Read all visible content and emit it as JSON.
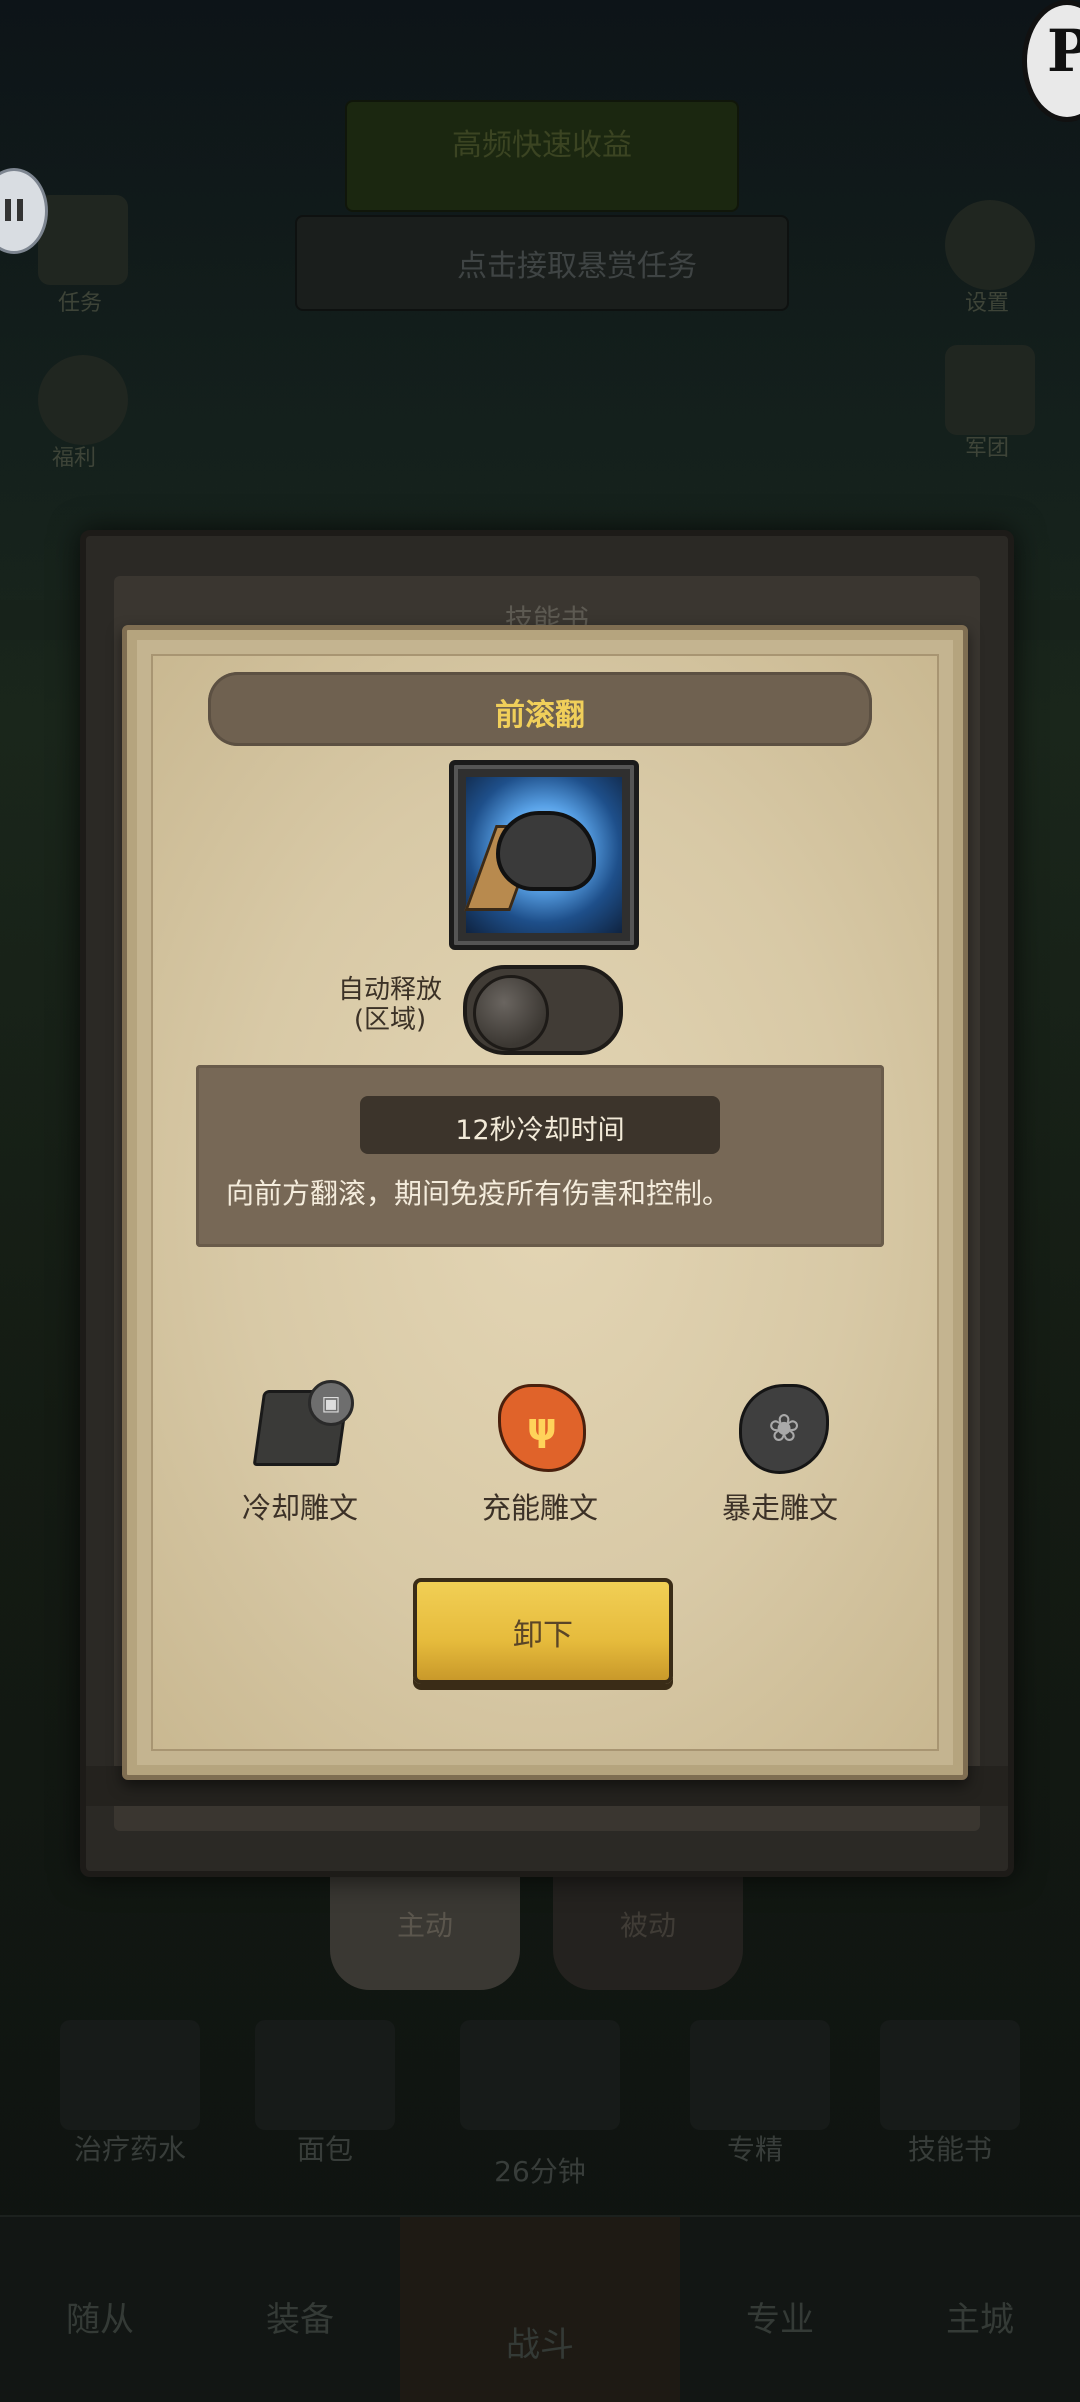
{
  "background": {
    "top_banner": "高频快速收益",
    "quest_button": "点击接取悬赏任务",
    "left_icons": [
      "任务",
      "福利"
    ],
    "right_icons": [
      "设置",
      "军团"
    ],
    "skill_book_title": "技能书",
    "tabs": [
      "主动",
      "被动"
    ],
    "items": [
      "治疗药水",
      "面包",
      "专精",
      "技能书"
    ],
    "timer": "26分钟",
    "nav": [
      "随从",
      "装备",
      "战斗",
      "专业",
      "主城"
    ],
    "avatar_letter": "P"
  },
  "dialog": {
    "title": "前滚翻",
    "skill_icon": "forward-roll-skill-icon",
    "auto_release_label_line1": "自动释放",
    "auto_release_label_line2": "(区域)",
    "auto_release_on": false,
    "cooldown": "12秒冷却时间",
    "description": "向前方翻滚，期间免疫所有伤害和控制。",
    "runes": [
      {
        "label": "冷却雕文",
        "icon": "lock-icon",
        "locked": true
      },
      {
        "label": "充能雕文",
        "icon": "charge-rune-icon",
        "locked": false
      },
      {
        "label": "暴走雕文",
        "icon": "rage-rune-icon",
        "locked": false
      }
    ],
    "unequip_label": "卸下"
  },
  "colors": {
    "title_text": "#f0cf5a",
    "button_yellow": "#e6bb3c",
    "paper": "#d8c9a6"
  }
}
